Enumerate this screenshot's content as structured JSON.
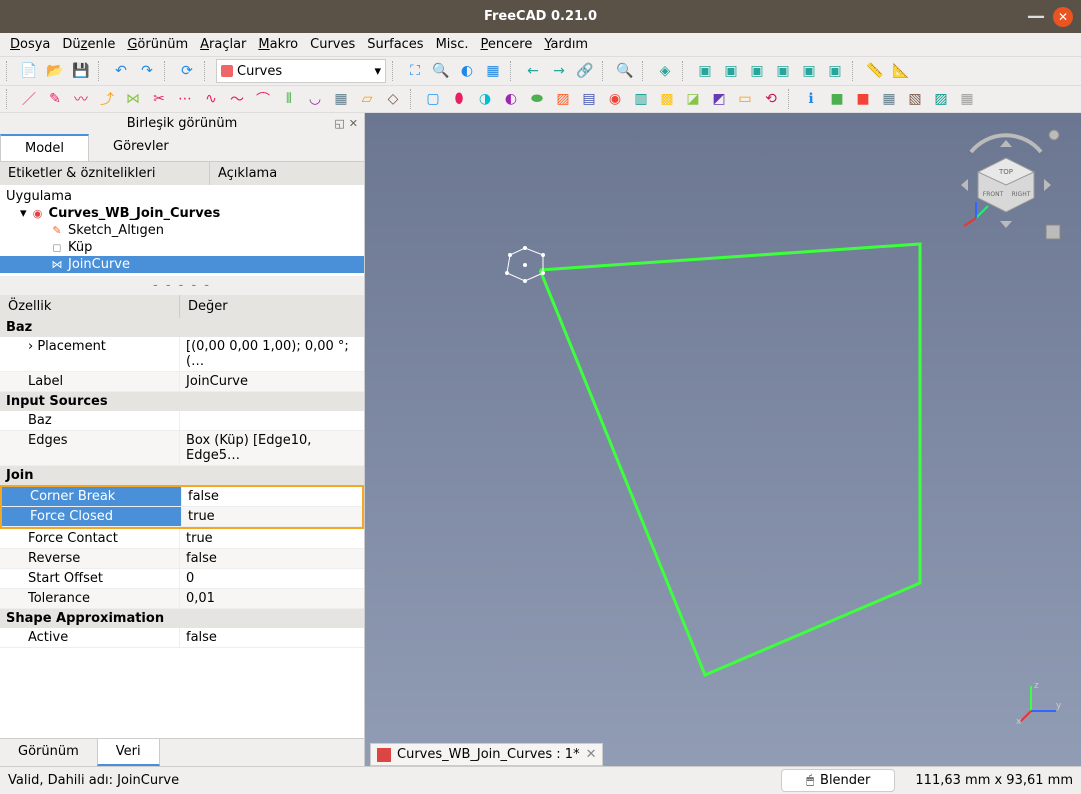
{
  "window": {
    "title": "FreeCAD 0.21.0"
  },
  "menu": [
    "Dosya",
    "Düzenle",
    "Görünüm",
    "Araçlar",
    "Makro",
    "Curves",
    "Surfaces",
    "Misc.",
    "Pencere",
    "Yardım"
  ],
  "workbench": {
    "name": "Curves"
  },
  "panel": {
    "title": "Birleşik görünüm",
    "tabs": {
      "model": "Model",
      "tasks": "Görevler"
    }
  },
  "tree": {
    "headers": [
      "Etiketler & öznitelikleri",
      "Açıklama"
    ],
    "app": "Uygulama",
    "doc": "Curves_WB_Join_Curves",
    "items": [
      {
        "label": "Sketch_Altıgen",
        "icon": "sketch",
        "color": "#e63"
      },
      {
        "label": "Küp",
        "icon": "cube",
        "color": "#888"
      },
      {
        "label": "JoinCurve",
        "icon": "join",
        "color": "#555",
        "selected": true
      }
    ]
  },
  "props": {
    "headers": [
      "Özellik",
      "Değer"
    ],
    "groups": [
      {
        "name": "Baz",
        "rows": [
          {
            "k": "Placement",
            "v": "[(0,00 0,00 1,00); 0,00 °; (…"
          },
          {
            "k": "Label",
            "v": "JoinCurve"
          }
        ]
      },
      {
        "name": "Input Sources",
        "rows": [
          {
            "k": "Baz",
            "v": ""
          },
          {
            "k": "Edges",
            "v": "Box (Küp) [Edge10, Edge5…"
          }
        ]
      },
      {
        "name": "Join",
        "highlight": true,
        "rows": [
          {
            "k": "Corner Break",
            "v": "false",
            "sel": true
          },
          {
            "k": "Force Closed",
            "v": "true",
            "sel": true
          },
          {
            "k": "Force Contact",
            "v": "true"
          },
          {
            "k": "Reverse",
            "v": "false"
          },
          {
            "k": "Start Offset",
            "v": "0"
          },
          {
            "k": "Tolerance",
            "v": "0,01"
          }
        ]
      },
      {
        "name": "Shape Approximation",
        "rows": [
          {
            "k": "Active",
            "v": "false"
          }
        ]
      }
    ]
  },
  "bottomTabs": {
    "view": "Görünüm",
    "data": "Veri"
  },
  "docTab": "Curves_WB_Join_Curves : 1*",
  "status": {
    "left": "Valid, Dahili adı: JoinCurve",
    "nav": "Blender",
    "dims": "111,63 mm x 93,61 mm"
  },
  "navCube": {
    "top": "TOP",
    "front": "FRONT",
    "right": "RIGHT"
  },
  "axes": {
    "x": "x",
    "y": "y",
    "z": "z"
  }
}
